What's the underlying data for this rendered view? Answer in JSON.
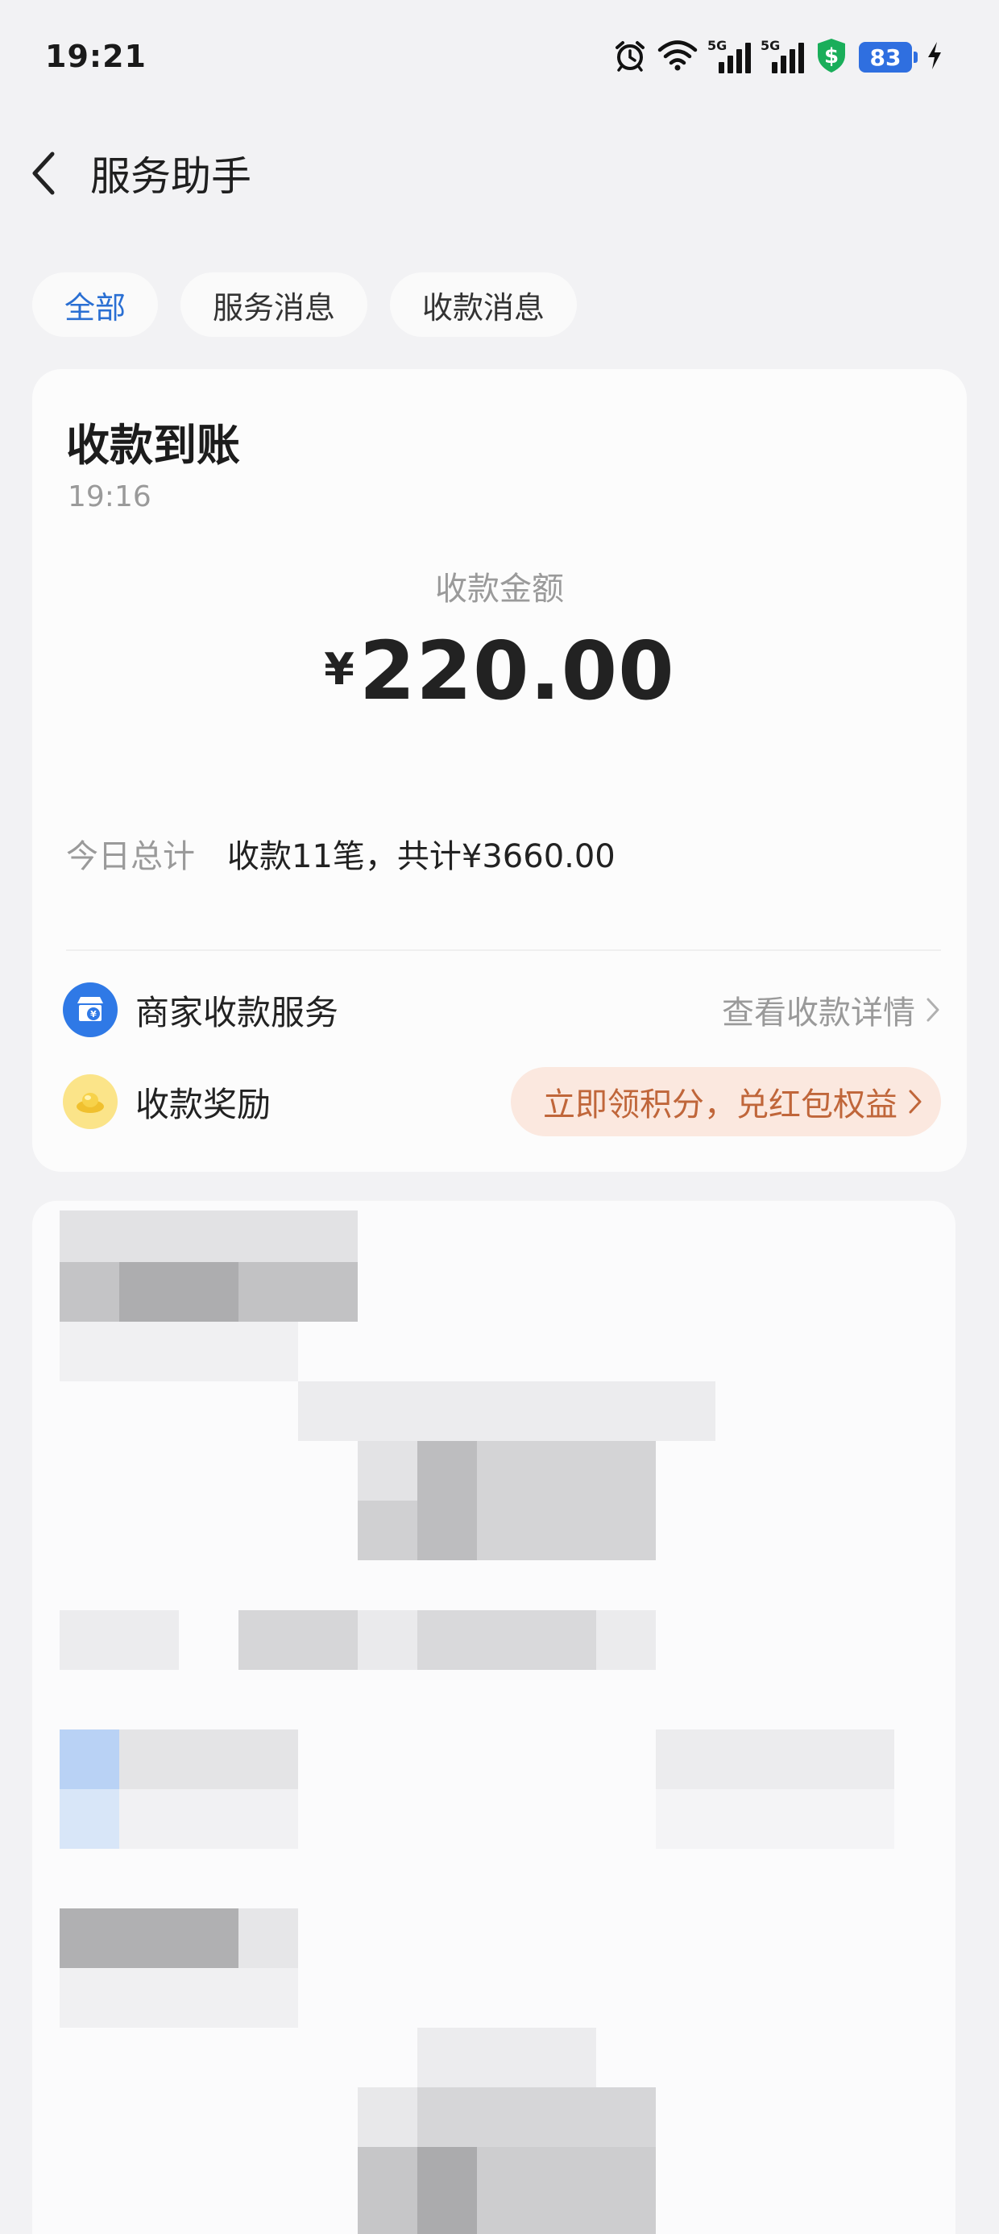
{
  "status_bar": {
    "time": "19:21",
    "network_tag_1": "5G",
    "network_tag_2": "5G",
    "battery": "83",
    "icons": [
      "alarm-icon",
      "wifi-icon",
      "signal-5g-icon",
      "signal-5g-icon",
      "security-shield-icon",
      "battery-icon",
      "charging-icon"
    ]
  },
  "header": {
    "title": "服务助手",
    "back_icon": "chevron-left-icon"
  },
  "tabs": [
    {
      "label": "全部",
      "active": true
    },
    {
      "label": "服务消息",
      "active": false
    },
    {
      "label": "收款消息",
      "active": false
    }
  ],
  "card": {
    "title": "收款到账",
    "time": "19:16",
    "amount_label": "收款金额",
    "currency": "¥",
    "amount": "220.00",
    "summary_label": "今日总计",
    "summary_value": "收款11笔，共计¥3660.00",
    "merchant_label": "商家收款服务",
    "merchant_link": "查看收款详情",
    "reward_label": "收款奖励",
    "reward_action": "立即领积分，兑红包权益"
  },
  "colors": {
    "accent_blue": "#2a6fd3",
    "reward_bg": "#fbe8df",
    "reward_text": "#c0663a",
    "battery": "#2f6fe0",
    "shield": "#1aae5a"
  }
}
